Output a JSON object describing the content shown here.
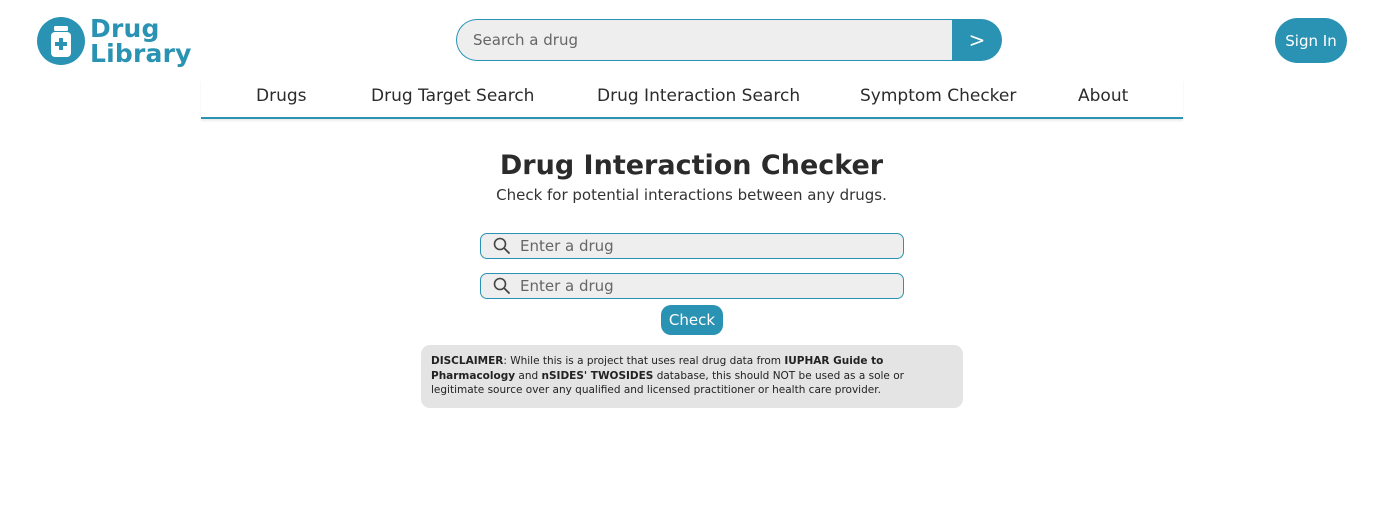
{
  "brand": {
    "line1": "Drug",
    "line2": "Library",
    "color": "#2a93b3"
  },
  "search": {
    "placeholder": "Search a drug",
    "button_label": ">"
  },
  "auth": {
    "sign_in_label": "Sign In"
  },
  "nav": {
    "items": [
      {
        "label": "Drugs"
      },
      {
        "label": "Drug Target Search"
      },
      {
        "label": "Drug Interaction Search"
      },
      {
        "label": "Symptom Checker"
      },
      {
        "label": "About"
      }
    ]
  },
  "main": {
    "title": "Drug Interaction Checker",
    "subtitle": "Check for potential interactions between any drugs.",
    "drug_inputs": [
      {
        "placeholder": "Enter a drug",
        "value": ""
      },
      {
        "placeholder": "Enter a drug",
        "value": ""
      }
    ],
    "check_label": "Check"
  },
  "disclaimer": {
    "label": "DISCLAIMER",
    "text1": ": While this is a project that uses real drug data from ",
    "source1": "IUPHAR Guide to Pharmacology",
    "text2": " and ",
    "source2": "nSIDES' TWOSIDES",
    "text3": " database, this should NOT be used as a sole or legitimate source over any qualified and licensed practitioner or health care provider."
  },
  "icons": {
    "logo": "medicine-bottle-icon",
    "field_search": "search-icon"
  }
}
